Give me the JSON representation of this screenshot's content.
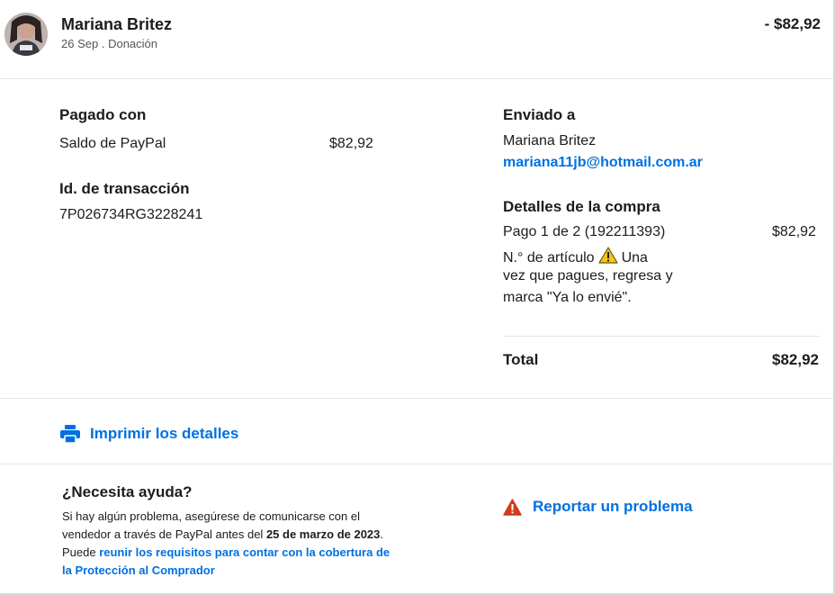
{
  "header": {
    "name": "Mariana Britez",
    "date": "26 Sep",
    "separator": ".",
    "type": "Donación",
    "amount": "- $82,92"
  },
  "paid_with": {
    "label": "Pagado con",
    "method": "Saldo de PayPal",
    "amount": "$82,92"
  },
  "transaction": {
    "label": "Id. de transacción",
    "id": "7P026734RG3228241"
  },
  "sent_to": {
    "label": "Enviado a",
    "name": "Mariana Britez",
    "email": "mariana11jb@hotmail.com.ar"
  },
  "purchase": {
    "label": "Detalles de la compra",
    "line1": "Pago 1 de 2 (192211393)",
    "line2_before": "N.° de artículo",
    "line2_after": "Una",
    "line3": "vez que pagues, regresa y",
    "line4": "marca \"Ya lo envié\".",
    "amount": "$82,92"
  },
  "total": {
    "label": "Total",
    "amount": "$82,92"
  },
  "print": {
    "label": "Imprimir los detalles",
    "icon": "printer-icon"
  },
  "help": {
    "title": "¿Necesita ayuda?",
    "text1": "Si hay algún problema, asegúrese de comunicarse con el vendedor a través de PayPal antes del ",
    "date": "25 de marzo de 2023",
    "text2": ". Puede ",
    "link": "reunir los requisitos para contar con la cobertura de la Protección al Comprador"
  },
  "report": {
    "label": "Reportar un problema",
    "icon": "warning-icon"
  },
  "colors": {
    "link": "#0070e0",
    "warning_red": "#d03b1f",
    "warning_yellow": "#f5c518"
  }
}
